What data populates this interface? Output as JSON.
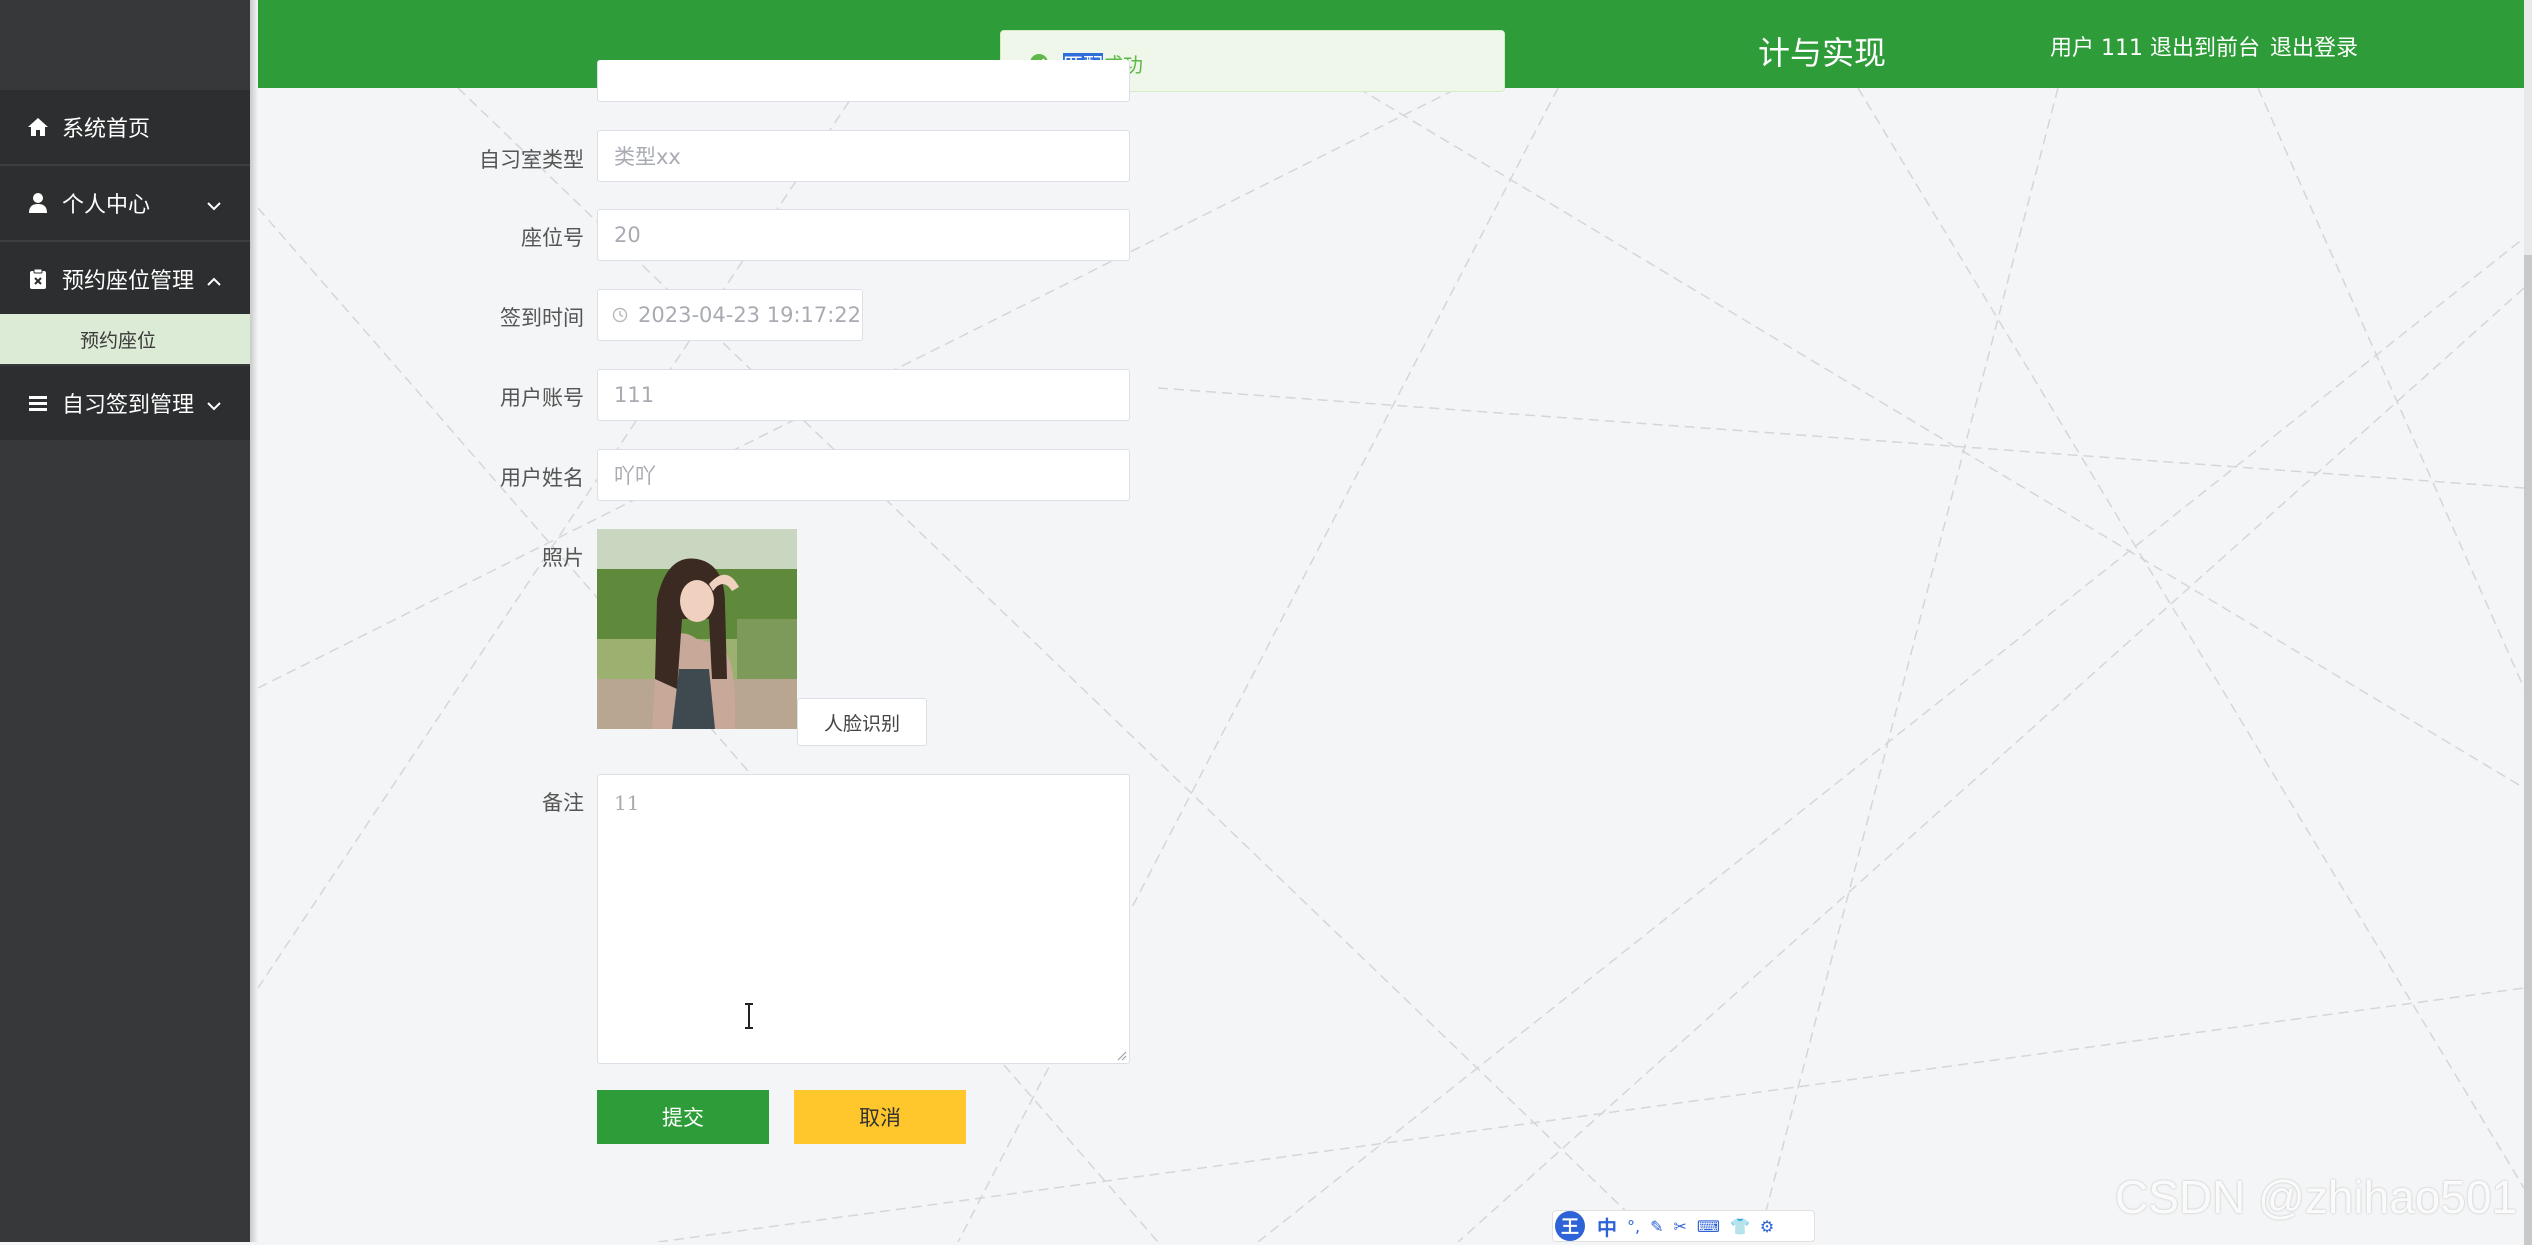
{
  "sidebar": {
    "items": [
      {
        "label": "系统首页",
        "icon": "home-icon"
      },
      {
        "label": "个人中心",
        "icon": "user-icon"
      },
      {
        "label": "预约座位管理",
        "icon": "clipboard-icon"
      },
      {
        "label": "自习签到管理",
        "icon": "list-icon"
      }
    ],
    "sub_items": [
      {
        "label": "预约座位"
      }
    ]
  },
  "header": {
    "title": "计与实现",
    "user_label": "用户 111",
    "back_to_front": "退出到前台",
    "logout": "退出登录"
  },
  "toast": {
    "selected_text": "匹配",
    "rest_text": "成功"
  },
  "form": {
    "room_type": {
      "label": "自习室类型",
      "placeholder": "类型xx"
    },
    "seat_no": {
      "label": "座位号",
      "value": "20"
    },
    "checkin_time": {
      "label": "签到时间",
      "value": "2023-04-23 19:17:22"
    },
    "user_account": {
      "label": "用户账号",
      "value": "111"
    },
    "user_name": {
      "label": "用户姓名",
      "value": "吖吖"
    },
    "photo": {
      "label": "照片",
      "button": "人脸识别"
    },
    "remark": {
      "label": "备注",
      "value": "11"
    },
    "submit": "提交",
    "cancel": "取消"
  },
  "ime": {
    "logo": "王",
    "mode": "中"
  },
  "watermark": "CSDN @zhihao501",
  "colors": {
    "header_green": "#2f9c3a",
    "sidebar_dark": "#2d2e2f",
    "submit_green": "#2f9c3a",
    "cancel_yellow": "#ffc72b",
    "submenu_bg": "#dcebd6"
  }
}
